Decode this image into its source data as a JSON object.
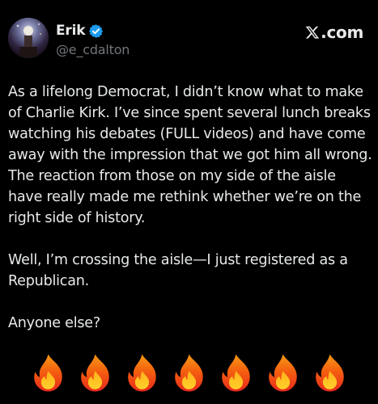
{
  "author": {
    "name": "Erik",
    "handle": "@e_cdalton",
    "verified": true
  },
  "brand": {
    "label": ".com",
    "icon": "x-logo-icon"
  },
  "tweet": {
    "paragraphs": [
      "As a lifelong Democrat, I didn’t know what to make of Charlie Kirk. I’ve since spent several lunch breaks watching his debates (FULL videos) and have come away with the impression that we got him all wrong. The reaction from those on my side of the aisle have really made me rethink whether we’re on the right side of history.",
      "Well, I’m crossing the aisle—I just registered as a Republican.",
      "Anyone else?"
    ],
    "emojis": [
      "🔥",
      "🔥",
      "🔥",
      "🔥",
      "🔥",
      "🔥",
      "🔥"
    ]
  },
  "colors": {
    "background": "#000000",
    "text": "#e7e9ea",
    "muted": "#71767b",
    "verified_badge": "#1d9bf0"
  }
}
